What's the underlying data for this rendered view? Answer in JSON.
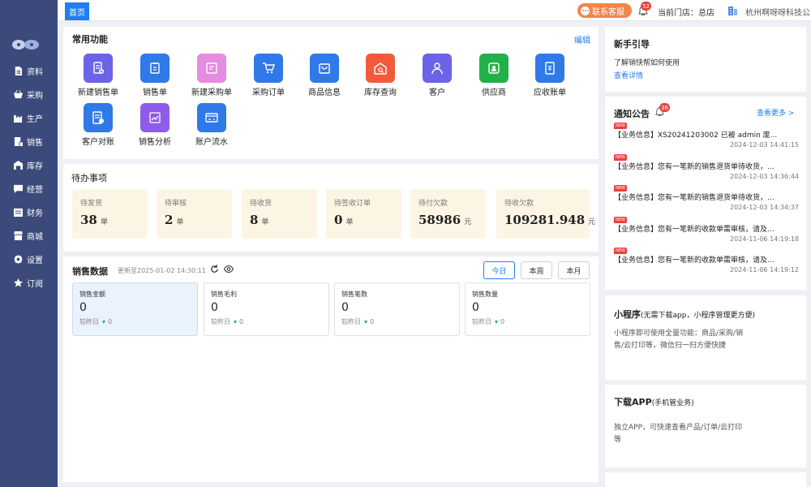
{
  "sidebar": {
    "items": [
      {
        "label": "资料",
        "icon": "document-icon"
      },
      {
        "label": "采购",
        "icon": "basket-icon"
      },
      {
        "label": "生产",
        "icon": "factory-icon"
      },
      {
        "label": "销售",
        "icon": "sales-icon"
      },
      {
        "label": "库存",
        "icon": "warehouse-icon"
      },
      {
        "label": "经营",
        "icon": "chat-icon"
      },
      {
        "label": "财务",
        "icon": "finance-icon"
      },
      {
        "label": "商城",
        "icon": "store-icon"
      },
      {
        "label": "设置",
        "icon": "gear-icon"
      },
      {
        "label": "订阅",
        "icon": "star-icon"
      }
    ]
  },
  "topbar": {
    "home_tab": "首页",
    "customer_service": "联系客服",
    "notification_count": "52",
    "current_store": "当前门店：总店",
    "company": "杭州啊呀呀科技公"
  },
  "functions": {
    "title": "常用功能",
    "edit": "编辑",
    "items": [
      {
        "label": "新建销售单",
        "color": "#6b63e8",
        "icon": "new-sales-order-icon"
      },
      {
        "label": "销售单",
        "color": "#2f79e8",
        "icon": "sales-order-icon"
      },
      {
        "label": "新建采购单",
        "color": "#e58be0",
        "icon": "new-purchase-order-icon"
      },
      {
        "label": "采购订单",
        "color": "#2f79e8",
        "icon": "cart-icon"
      },
      {
        "label": "商品信息",
        "color": "#2f79e8",
        "icon": "bag-icon"
      },
      {
        "label": "库存查询",
        "color": "#f25a3a",
        "icon": "inventory-search-icon"
      },
      {
        "label": "客户",
        "color": "#6b63e8",
        "icon": "customer-icon"
      },
      {
        "label": "供应商",
        "color": "#22b04a",
        "icon": "supplier-icon"
      },
      {
        "label": "应收账单",
        "color": "#2f79e8",
        "icon": "receivable-icon"
      },
      {
        "label": "客户对账",
        "color": "#2f79e8",
        "icon": "reconcile-icon"
      },
      {
        "label": "销售分析",
        "color": "#8d5ce8",
        "icon": "analysis-icon"
      },
      {
        "label": "账户流水",
        "color": "#2f79e8",
        "icon": "account-flow-icon"
      }
    ]
  },
  "todos": {
    "title": "待办事项",
    "items": [
      {
        "label": "待发货",
        "value": "38",
        "unit": "单"
      },
      {
        "label": "待审核",
        "value": "2",
        "unit": "单"
      },
      {
        "label": "待收货",
        "value": "8",
        "unit": "单"
      },
      {
        "label": "待签收订单",
        "value": "0",
        "unit": "单"
      },
      {
        "label": "待付欠款",
        "value": "58986",
        "unit": "元"
      },
      {
        "label": "待收欠款",
        "value": "109281.948",
        "unit": "元"
      }
    ]
  },
  "sales": {
    "title": "销售数据",
    "updated": "更新至2025-01-02 14:30:11",
    "periods": [
      "今日",
      "本周",
      "本月"
    ],
    "metrics": [
      {
        "label": "销售金额",
        "value": "0",
        "compare": "较昨日",
        "delta": "0"
      },
      {
        "label": "销售毛利",
        "value": "0",
        "compare": "较昨日",
        "delta": "0"
      },
      {
        "label": "销售笔数",
        "value": "0",
        "compare": "较昨日",
        "delta": "0"
      },
      {
        "label": "销售数量",
        "value": "0",
        "compare": "较昨日",
        "delta": "0"
      }
    ]
  },
  "guide": {
    "title": "新手引导",
    "text": "了解销快帮如何使用",
    "link": "查看详情"
  },
  "notices": {
    "title": "通知公告",
    "count": "36",
    "more": "查看更多 >",
    "new_tag": "NEW",
    "items": [
      {
        "text": "【业务信息】XS20241203002 已被 admin 废...",
        "date": "2024-12-03 14:41:15"
      },
      {
        "text": "【业务信息】您有一笔新的销售退货单待收货，...",
        "date": "2024-12-03 14:36:44"
      },
      {
        "text": "【业务信息】您有一笔新的销售退货单待收货，...",
        "date": "2024-12-03 14:34:37"
      },
      {
        "text": "【业务信息】您有一笔新的收款单需审核，请及...",
        "date": "2024-11-06 14:19:18"
      },
      {
        "text": "【业务信息】您有一笔新的收款单需审核，请及...",
        "date": "2024-11-06 14:19:12"
      }
    ]
  },
  "mini_program": {
    "title": "小程序",
    "subtitle": "(无需下载app，小程序管理更方便)",
    "text": "小程序即可使用全量功能：商品/采购/销售/云打印等，微信扫一扫方便快捷"
  },
  "app": {
    "title": "下载APP",
    "subtitle": "(手机管业务)",
    "text": "独立APP，可快速查看产品/订单/云打印等"
  }
}
